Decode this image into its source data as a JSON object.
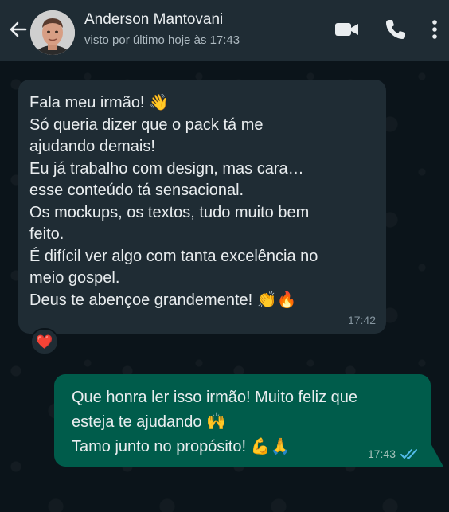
{
  "header": {
    "contact_name": "Anderson Mantovani",
    "last_seen": "visto por último hoje às 17:43"
  },
  "incoming": {
    "lines": [
      "Fala meu irmão! 👋",
      "Só queria dizer que o pack tá me",
      "ajudando demais!",
      "Eu já trabalho com design, mas cara…",
      "esse conteúdo tá sensacional.",
      "Os mockups, os textos, tudo muito bem",
      "feito.",
      "É difícil ver algo com tanta excelência no",
      "meio gospel.",
      "Deus te abençoe grandemente! 👏🔥"
    ],
    "time": "17:42",
    "reaction": "❤️"
  },
  "outgoing": {
    "lines": [
      "Que honra ler isso irmão! Muito feliz que",
      "esteja te ajudando 🙌",
      "Tamo junto no propósito! 💪🙏"
    ],
    "time": "17:43",
    "status_icon": "read-double-check-icon"
  },
  "colors": {
    "header_bg": "#1f2c34",
    "chat_bg": "#0b141a",
    "incoming_bubble": "#1f2c34",
    "outgoing_bubble": "#005c4b",
    "read_ticks": "#53bdeb"
  }
}
